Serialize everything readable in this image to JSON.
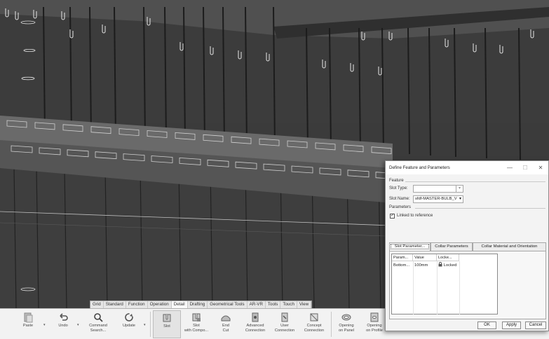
{
  "ribbon_tabs": [
    "Grid",
    "Standard",
    "Function",
    "Operation",
    "Detail",
    "Drafting",
    "Geometrical Tools",
    "AR-VR",
    "Tools",
    "Touch",
    "View"
  ],
  "active_ribbon_tab": "Detail",
  "ribbon": {
    "paste": "Paste",
    "undo": "Undo",
    "command_search": "Command\nSearch...",
    "update": "Update",
    "slot": "Slot",
    "slot_with_compo": "Slot\nwith Compo...",
    "end_cut": "End\nCut",
    "advanced_connection": "Advanced\nConnection",
    "user_connection": "User\nConnection",
    "concept_connection": "Concept\nConnection",
    "opening_on_panel": "Opening\non Panel",
    "opening_on_profile": "Opening\non Profile"
  },
  "dialog": {
    "title": "Define Feature and Parameters",
    "minimize": "—",
    "maximize": "☐",
    "close": "✕",
    "feature_section": "Feature",
    "slot_type_label": "Slot Type:",
    "slot_type_value": "",
    "slot_name_label": "Slot Name:",
    "slot_name_value": "sfdf-MASTER-BULB_V",
    "parameters_section": "Parameters",
    "linked_label": "Linked to reference",
    "linked_checked": "✓",
    "tabs": [
      "Slot Parameter...",
      "Collar Parameters",
      "Collar Material and Orientation"
    ],
    "active_tab": 0,
    "table": {
      "headers": [
        "Param...",
        "Value",
        "Locke..."
      ],
      "rows": [
        {
          "param": "Bottom...",
          "value": "100mm",
          "locked": "Locked"
        }
      ]
    },
    "ok": "OK",
    "apply": "Apply",
    "cancel": "Cancel"
  },
  "colors": {
    "viewport_bg": "#3b3b3b",
    "ribbon_bg": "#f2f2f2",
    "dialog_bg": "#f3f3f3"
  }
}
